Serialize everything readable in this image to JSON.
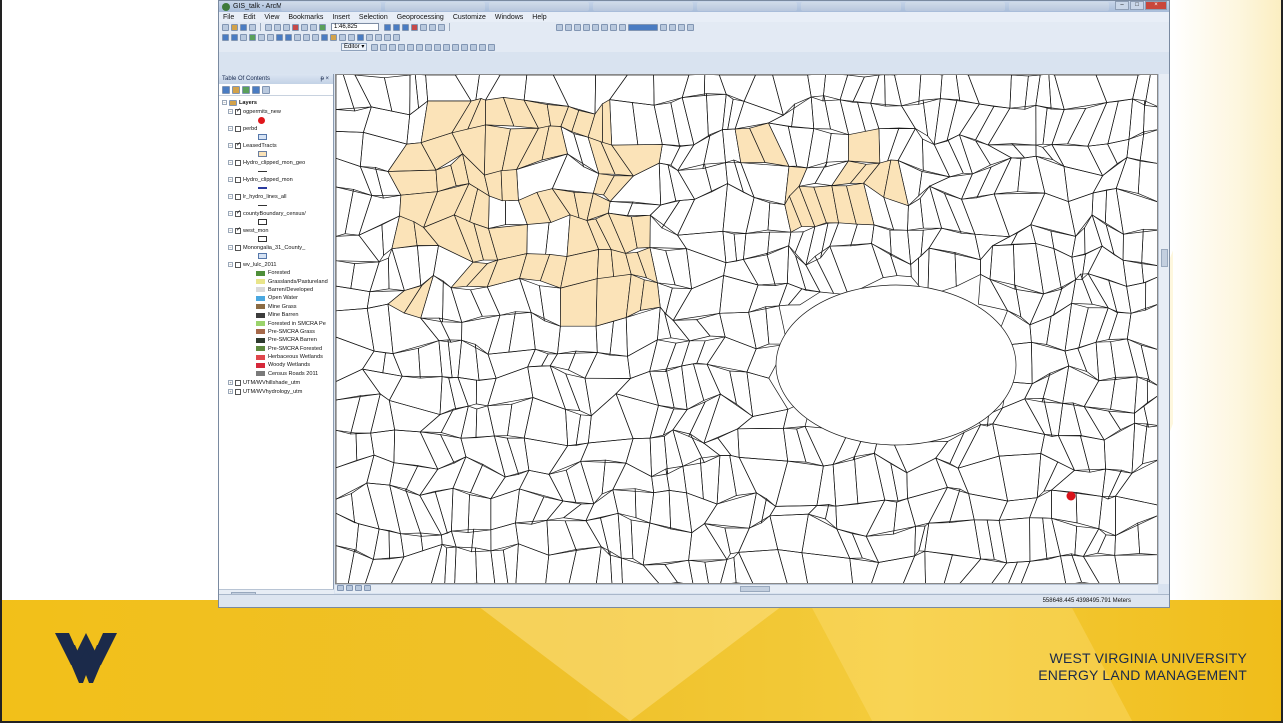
{
  "window": {
    "title": "GIS_talk - ArcMap - ArcInfo",
    "controls": [
      "–",
      "□",
      "×"
    ]
  },
  "menu": [
    "File",
    "Edit",
    "View",
    "Bookmarks",
    "Insert",
    "Selection",
    "Geoprocessing",
    "Customize",
    "Windows",
    "Help"
  ],
  "toolbar": {
    "scale": "1:46,825"
  },
  "editor": {
    "label": "Editor ▾"
  },
  "toc": {
    "title": "Table Of Contents",
    "pin": "ᵽ ×",
    "root": "Layers",
    "layers": [
      {
        "name": "ogpermits_new",
        "checked": true,
        "symbol": "dot"
      },
      {
        "name": "perbd",
        "checked": false,
        "symbol": "box"
      },
      {
        "name": "LeasedTracts",
        "checked": true,
        "symbol": "tan"
      },
      {
        "name": "Hydro_clipped_mon_geo",
        "checked": false,
        "symbol": "line"
      },
      {
        "name": "Hydro_clipped_mon",
        "checked": false,
        "symbol": "blueline"
      },
      {
        "name": "lr_hydro_lines_all",
        "checked": false,
        "symbol": "line"
      },
      {
        "name": "countyBoundary_census/",
        "checked": true,
        "symbol": "box-white"
      },
      {
        "name": "west_mon",
        "checked": true,
        "symbol": "box-white"
      },
      {
        "name": "Monongalia_31_County_",
        "checked": false,
        "symbol": "box"
      },
      {
        "name": "wv_lulc_2011",
        "checked": false,
        "symbol": "none"
      }
    ],
    "legend": [
      {
        "label": "Forested",
        "color": "#4f8f3a"
      },
      {
        "label": "Grasslands/Pastureland",
        "color": "#e9e58a"
      },
      {
        "label": "Barren/Developed",
        "color": "#d9d9d9"
      },
      {
        "label": "Open Water",
        "color": "#4aa8e0"
      },
      {
        "label": "Mine Grass",
        "color": "#8b6b43"
      },
      {
        "label": "Mine Barren",
        "color": "#3c3c3c"
      },
      {
        "label": "Forested in SMCRA Pe",
        "color": "#9bd36b"
      },
      {
        "label": "Pre-SMCRA Grass",
        "color": "#a6694a"
      },
      {
        "label": "Pre-SMCRA Barren",
        "color": "#2e3a2e"
      },
      {
        "label": "Pre-SMCRA Forested",
        "color": "#5e8a3e"
      },
      {
        "label": "Herbaceous Wetlands",
        "color": "#e0474c"
      },
      {
        "label": "Woody Wetlands",
        "color": "#d6283a"
      },
      {
        "label": "Census Roads 2011",
        "color": "#7a7a7a"
      }
    ],
    "extra_layers": [
      {
        "name": "UTM/WVhillshade_utm",
        "checked": false
      },
      {
        "name": "UTM/WVhydrology_utm",
        "checked": false
      }
    ]
  },
  "status": {
    "coords": "558648.445  4398495.791 Meters"
  },
  "footer": {
    "line1": "WEST VIRGINIA UNIVERSITY",
    "line2": "ENERGY LAND MANAGEMENT"
  },
  "colors": {
    "leased_fill": "#fbe3b8",
    "permit_point": "#d8121a",
    "footer_gold": "#f2c019",
    "wvu_navy": "#1b2a4a"
  }
}
